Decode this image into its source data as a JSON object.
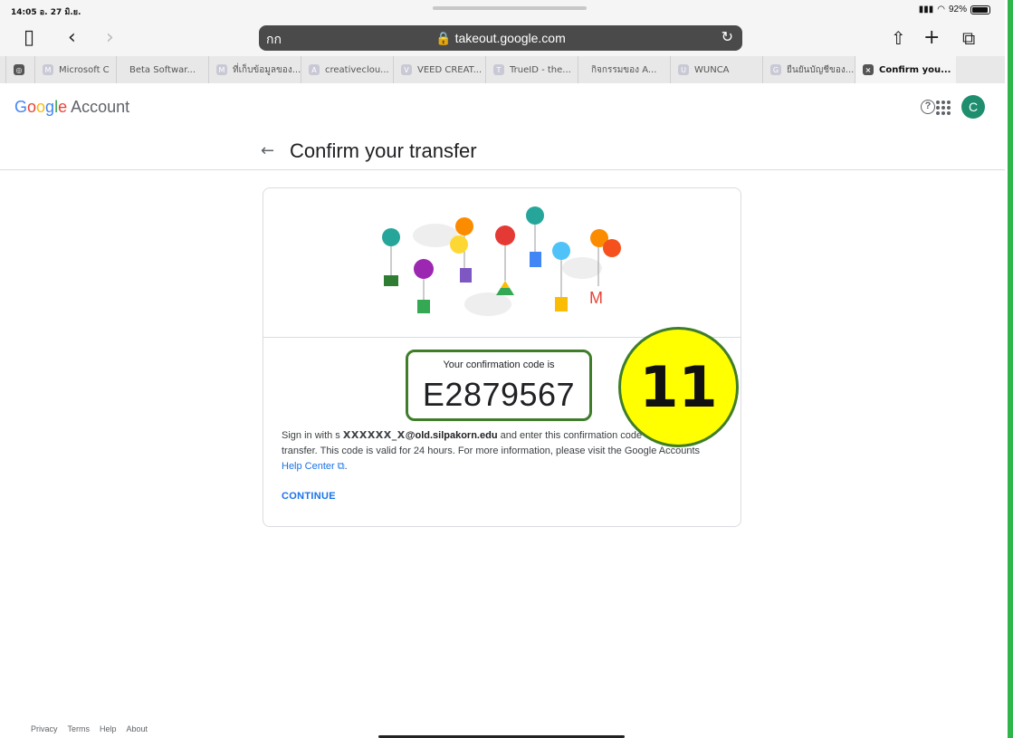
{
  "status_bar": {
    "time": "14:05 อ. 27 มิ.ย.",
    "battery": "92%"
  },
  "browser": {
    "text_size_label": "กก",
    "url": "takeout.google.com",
    "tabs": [
      {
        "label": "Microsoft C",
        "fav": "M"
      },
      {
        "label": "Beta Softwar...",
        "fav": ""
      },
      {
        "label": "ที่เก็บข้อมูลของ...",
        "fav": "M"
      },
      {
        "label": "creativeclou...",
        "fav": "A"
      },
      {
        "label": "VEED CREAT...",
        "fav": "V"
      },
      {
        "label": "TrueID - the...",
        "fav": "T"
      },
      {
        "label": "กิจกรรมของ A...",
        "fav": ""
      },
      {
        "label": "WUNCA",
        "fav": "U"
      },
      {
        "label": "ยืนยันบัญชีของ...",
        "fav": "G"
      },
      {
        "label": "Confirm you...",
        "fav": "×",
        "active": true
      }
    ]
  },
  "header": {
    "logo": {
      "g": "G",
      "o1": "o",
      "o2": "o",
      "g2": "g",
      "l": "l",
      "e": "e",
      "account": "Account"
    },
    "avatar_initial": "C",
    "help": "?"
  },
  "page": {
    "title": "Confirm your transfer",
    "back": "←"
  },
  "card": {
    "code_label": "Your confirmation code is",
    "code": "E2879567",
    "desc_prefix": "Sign in with s",
    "desc_mask": "XXXXXX_X",
    "desc_email": "@old.silpakorn.edu",
    "desc_middle": " and enter this confirmation code",
    "desc_line2": "transfer. This code is valid for 24 hours. For more information, please visit the Google Accounts",
    "help_link": "Help Center",
    "continue": "CONTINUE"
  },
  "annotation": {
    "number": "11"
  },
  "footer": {
    "links": [
      "Privacy",
      "Terms",
      "Help",
      "About"
    ]
  }
}
